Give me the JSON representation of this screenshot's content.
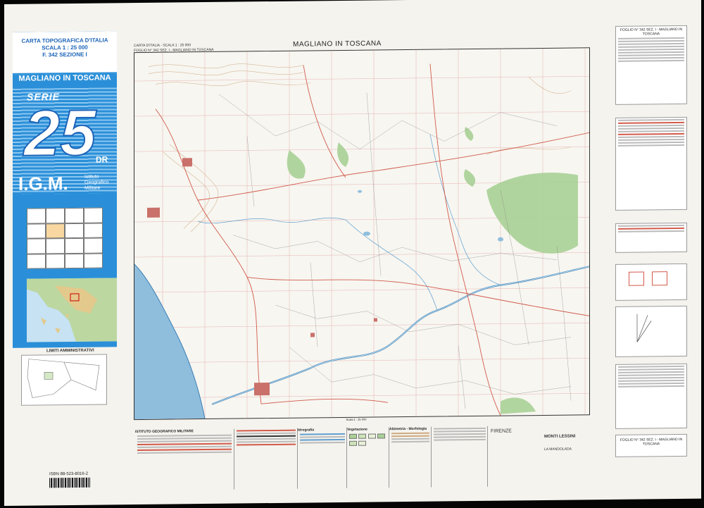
{
  "cover": {
    "heading1": "CARTA TOPOGRAFICA D'ITALIA",
    "heading2": "SCALA 1 : 25 000",
    "heading3": "F. 342 SEZIONE I",
    "title": "MAGLIANO IN TOSCANA",
    "serie": "SERIE",
    "number": "25",
    "unit": "DR",
    "igm": "I.G.M.",
    "igm_sub1": "Istituto",
    "igm_sub2": "Geografico",
    "igm_sub3": "Militare"
  },
  "bottom_left": {
    "limiti_title": "LIMITI AMMINISTRATIVI",
    "isbn": "ISBN 88-523-8016-2"
  },
  "map": {
    "small_left1": "CARTA D'ITALIA  -  SCALA 1 : 25 000",
    "small_left2": "FOGLIO N° 342 SEZ. I  -  MAGLIANO IN TOSCANA",
    "title": "MAGLIANO IN TOSCANA",
    "scale_note": "Scala 1 : 25 000"
  },
  "legend": {
    "publisher": "ISTITUTO GEOGRAFICO MILITARE",
    "section2": "Idrografia",
    "section3": "Vegetazione",
    "section4": "Altimetria - Morfologia",
    "place1": "FIRENZE",
    "place2": "MONTI LESSINI",
    "place3": "LA MANDOLADA"
  },
  "right_panel": {
    "top_title": "FOGLIO N° 342 SEZ. I - MAGLIANO IN TOSCANA",
    "bottom_title": "FOGLIO N° 342 SEZ. I - MAGLIANO IN TOSCANA"
  },
  "colors": {
    "water": "#8fbedd",
    "forest": "#9cc98a",
    "roads": "#d25a4a",
    "contours": "#c8a27a",
    "grid": "#d04040",
    "cover": "#2a8fd8"
  }
}
